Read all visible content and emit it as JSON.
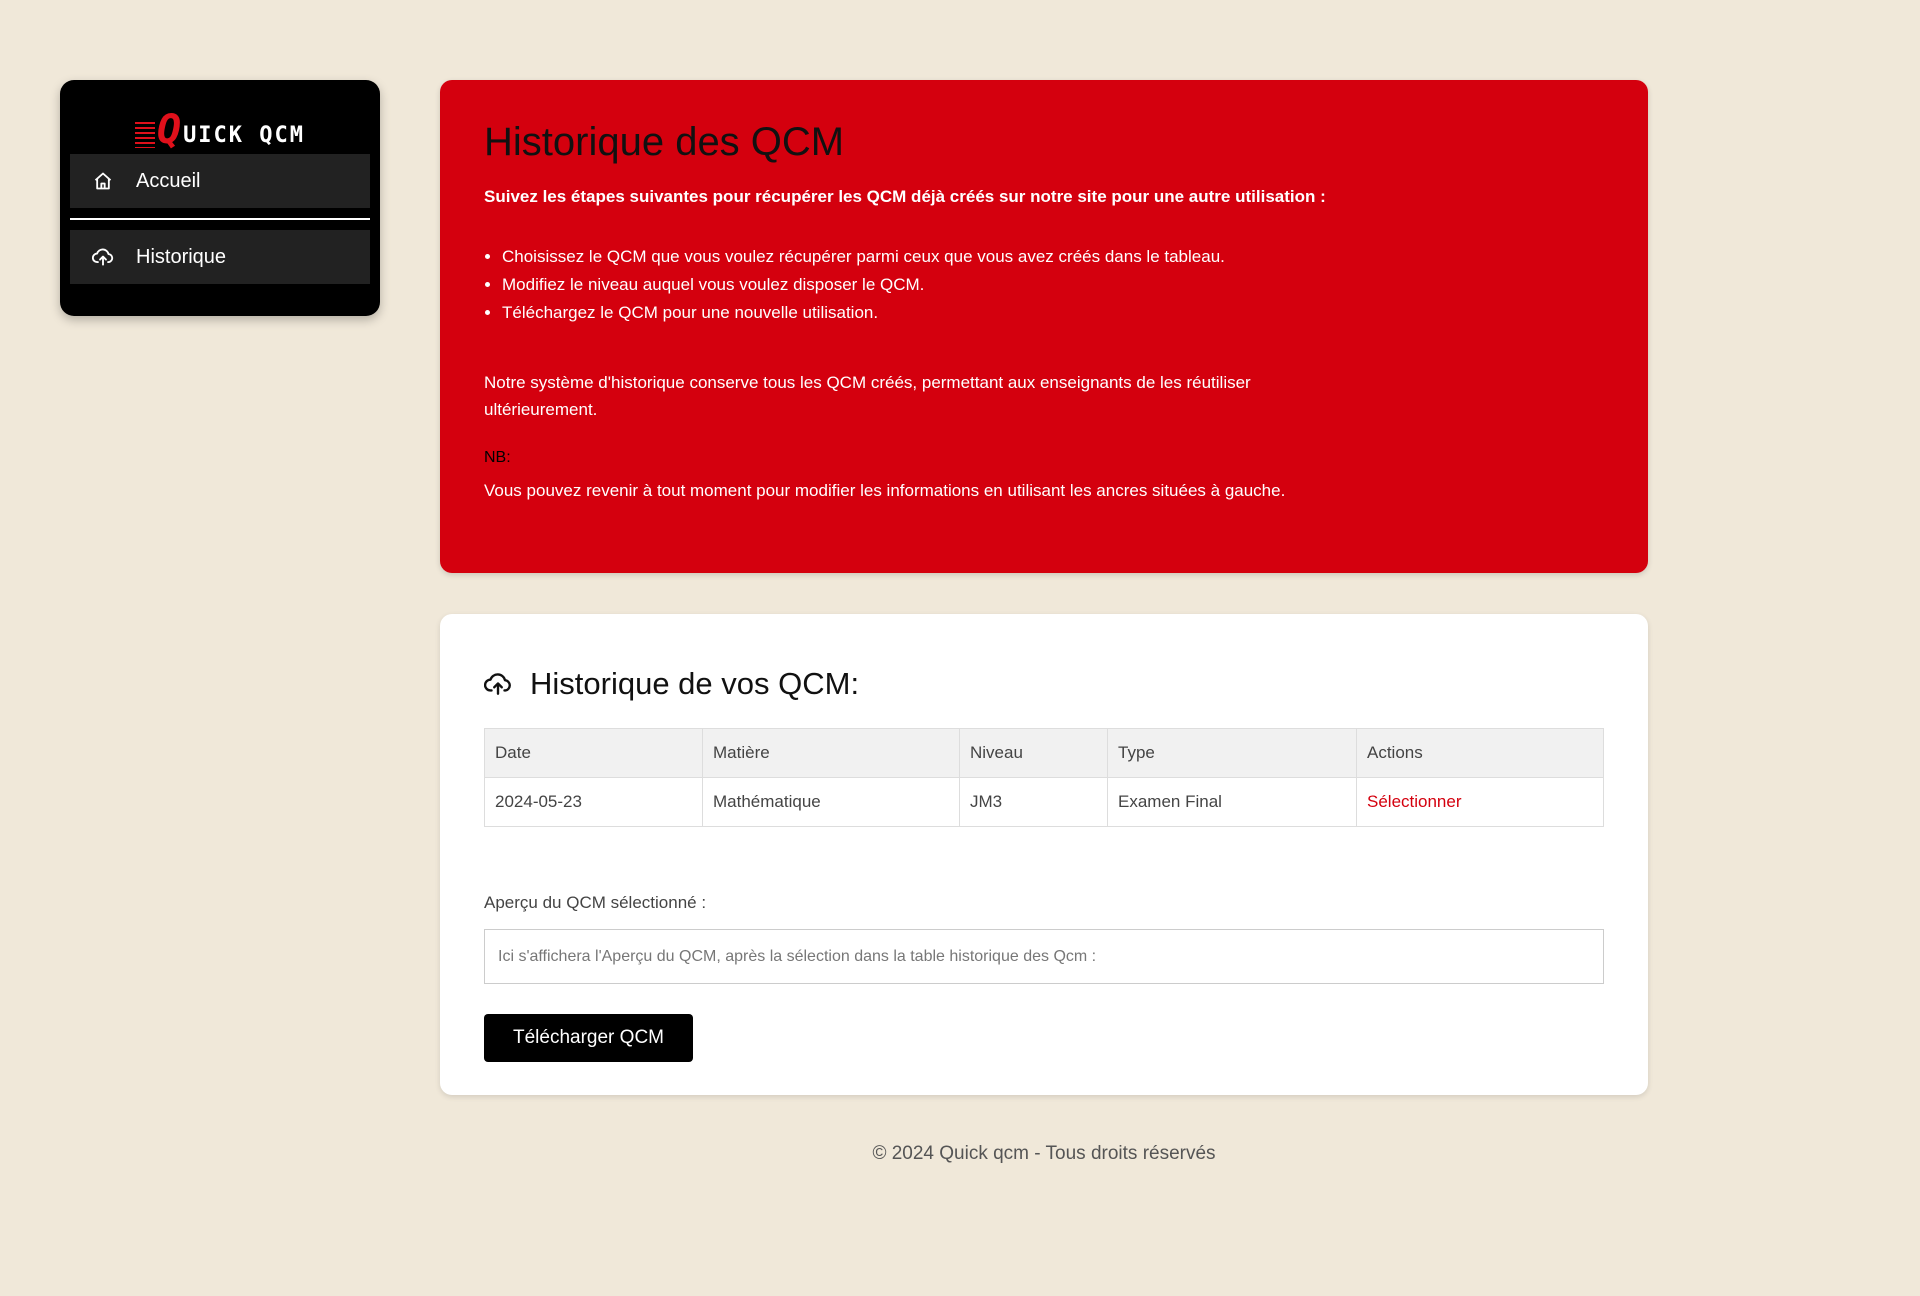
{
  "sidebar": {
    "logo_initial": "Q",
    "logo_rest": "UICK QCM",
    "items": [
      {
        "label": "Accueil",
        "icon": "home-icon"
      },
      {
        "label": "Historique",
        "icon": "cloud-upload-icon"
      }
    ]
  },
  "info": {
    "title": "Historique des QCM",
    "lead": "Suivez les étapes suivantes pour récupérer les QCM déjà créés sur notre site pour une autre utilisation :",
    "steps": [
      "Choisissez le QCM que vous voulez récupérer parmi ceux que vous avez créés dans le tableau.",
      "Modifiez le niveau auquel vous voulez disposer le QCM.",
      "Téléchargez le QCM pour une nouvelle utilisation."
    ],
    "paragraph": "Notre système d'historique conserve tous les QCM créés, permettant aux enseignants de les réutiliser ultérieurement.",
    "nb_label": "NB:",
    "nb_text": "Vous pouvez revenir à tout moment pour modifier les informations en utilisant les ancres situées à gauche."
  },
  "history": {
    "title": "Historique de vos QCM:",
    "columns": [
      "Date",
      "Matière",
      "Niveau",
      "Type",
      "Actions"
    ],
    "rows": [
      [
        "2024-05-23",
        "Mathématique",
        "JM3",
        "Examen Final",
        "Sélectionner"
      ]
    ],
    "preview_label": "Aperçu du QCM sélectionné :",
    "preview_placeholder": "Ici s'affichera l'Aperçu du QCM, après la sélection dans la table historique des Qcm :",
    "download_label": "Télécharger QCM"
  },
  "footer": {
    "text": "© 2024 Quick qcm - Tous droits réservés"
  },
  "colors": {
    "accent": "#d4000e",
    "background": "#f0e8d9",
    "sidebar": "#000000"
  }
}
